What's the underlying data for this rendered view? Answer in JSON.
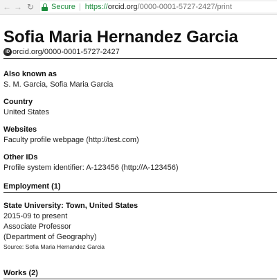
{
  "browser": {
    "back_icon": "back-arrow-icon",
    "forward_icon": "forward-arrow-icon",
    "reload_icon": "reload-icon",
    "secure_label": "Secure",
    "url_scheme": "https://",
    "url_host": "orcid.org",
    "url_path": "/0000-0001-5727-2427/print"
  },
  "profile": {
    "name": "Sofia Maria Hernandez Garcia",
    "orcid_badge": "iD",
    "orcid_url": "orcid.org/0000-0001-5727-2427"
  },
  "sections": {
    "also_known_as": {
      "title": "Also known as",
      "value": "S. M. Garcia, Sofia Maria Garcia"
    },
    "country": {
      "title": "Country",
      "value": "United States"
    },
    "websites": {
      "title": "Websites",
      "value": "Faculty profile webpage (http://test.com)"
    },
    "other_ids": {
      "title": "Other IDs",
      "value": "Profile system identifier: A-123456 (http://A-123456)"
    },
    "employment": {
      "title": "Employment (1)",
      "entry": {
        "org": "State University: Town, United States",
        "dates": "2015-09 to present",
        "role": "Associate Professor",
        "department": "(Department of Geography)",
        "source": "Source: Sofia Maria Hernandez Garcia"
      }
    },
    "works": {
      "title": "Works (2)"
    }
  },
  "colors": {
    "secure_green": "#1e8e3e",
    "text": "#222222",
    "rule": "#333333"
  }
}
